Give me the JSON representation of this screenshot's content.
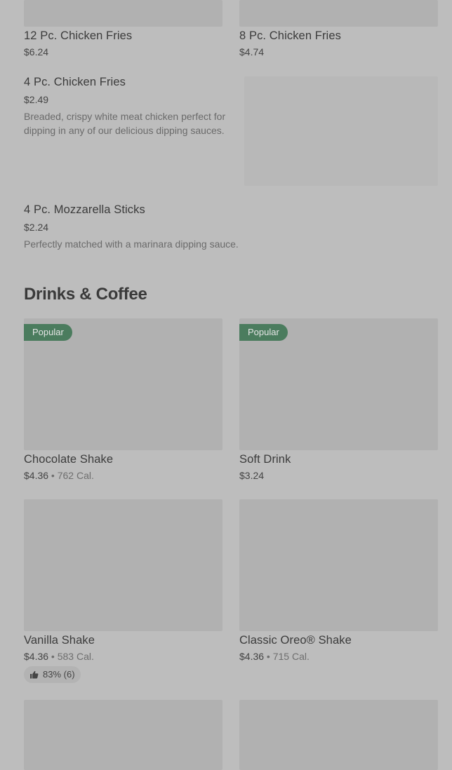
{
  "items_top": [
    {
      "name": "12 Pc. Chicken Fries",
      "price": "$6.24"
    },
    {
      "name": "8 Pc. Chicken Fries",
      "price": "$4.74"
    }
  ],
  "item_4pc_fries": {
    "name": "4 Pc. Chicken Fries",
    "price": "$2.49",
    "description": "Breaded, crispy white meat chicken perfect for dipping in any of our delicious dipping sauces."
  },
  "item_mozz": {
    "name": "4 Pc. Mozzarella Sticks",
    "price": "$2.24",
    "description": "Perfectly matched with a marinara dipping sauce."
  },
  "section": {
    "title": "Drinks & Coffee"
  },
  "drinks": [
    {
      "name": "Chocolate Shake",
      "price": "$4.36",
      "cal": " • 762 Cal.",
      "badge": "Popular"
    },
    {
      "name": "Soft Drink",
      "price": "$3.24",
      "cal": "",
      "badge": "Popular"
    },
    {
      "name": "Vanilla Shake",
      "price": "$4.36",
      "cal": " • 583 Cal.",
      "rating": "83% (6)"
    },
    {
      "name": "Classic Oreo® Shake",
      "price": "$4.36",
      "cal": " • 715 Cal."
    }
  ],
  "icons": {
    "rating": "thumbs-up-icon"
  }
}
